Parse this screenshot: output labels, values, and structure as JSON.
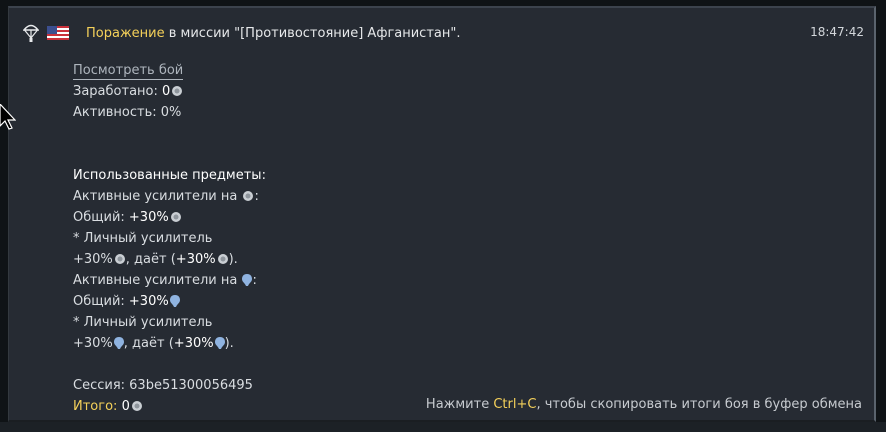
{
  "header": {
    "result_word": "Поражение",
    "mission_text": " в миссии \"[Противостояние] Афганистан\".",
    "timestamp": "18:47:42",
    "icons": [
      "parachute-icon",
      "usa-flag-icon"
    ]
  },
  "summary": {
    "view_battle_link": "Посмотреть бой",
    "earned_label": "Заработано: ",
    "earned_value": "0",
    "activity": "Активность: 0%"
  },
  "items": {
    "title": "Использованные предметы:",
    "silver": {
      "heading": "Активные усилители на ",
      "total_label": "Общий: ",
      "total_value": "+30%",
      "personal_line": "* Личный усилитель",
      "personal_value": "+30%",
      "gives_text": ", даёт (",
      "gives_value": "+30%",
      "close": ")."
    },
    "rp": {
      "heading": "Активные усилители на ",
      "total_label": "Общий: ",
      "total_value": "+30%",
      "personal_line": "* Личный усилитель",
      "personal_value": "+30%",
      "gives_text": ", даёт (",
      "gives_value": "+30%",
      "close": ")."
    }
  },
  "session": "Сессия: 63be51300056495",
  "total": {
    "label": "Итого:",
    "value": "0"
  },
  "copy_hint": {
    "prefix": "Нажмите ",
    "key": "Ctrl+C",
    "suffix": ", чтобы скопировать итоги боя в буфер обмена"
  },
  "colors": {
    "accent_yellow": "#f5d15a",
    "panel_bg": "#262b33",
    "rp_icon_blue": "#8fb3e0"
  }
}
